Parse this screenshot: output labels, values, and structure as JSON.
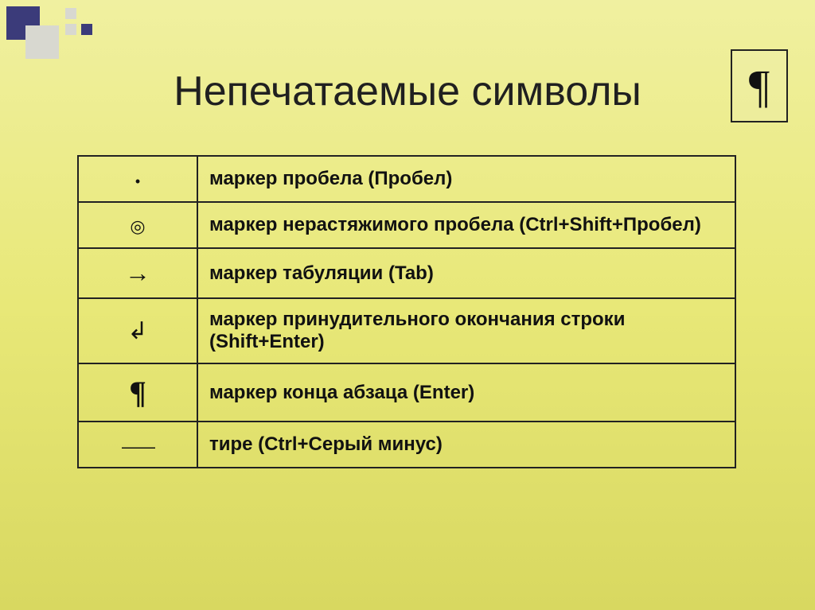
{
  "title": "Непечатаемые символы",
  "pilcrow_box": "¶",
  "rows": [
    {
      "symbol": "•",
      "symbol_class": "sym-dot",
      "description": "маркер пробела (Пробел)"
    },
    {
      "symbol": "◎",
      "symbol_class": "sym-circle",
      "description": "маркер нерастяжимого пробела (Ctrl+Shift+Пробел)"
    },
    {
      "symbol": "→",
      "symbol_class": "sym-arrow",
      "description": "маркер табуляции (Tab)"
    },
    {
      "symbol": "↲",
      "symbol_class": "sym-return",
      "description": "маркер принудительного окончания строки (Shift+Enter)"
    },
    {
      "symbol": "¶",
      "symbol_class": "sym-pilcrow",
      "description": "маркер конца абзаца (Enter)"
    },
    {
      "symbol": "——",
      "symbol_class": "sym-dash",
      "description": "тире (Ctrl+Серый минус)"
    }
  ]
}
